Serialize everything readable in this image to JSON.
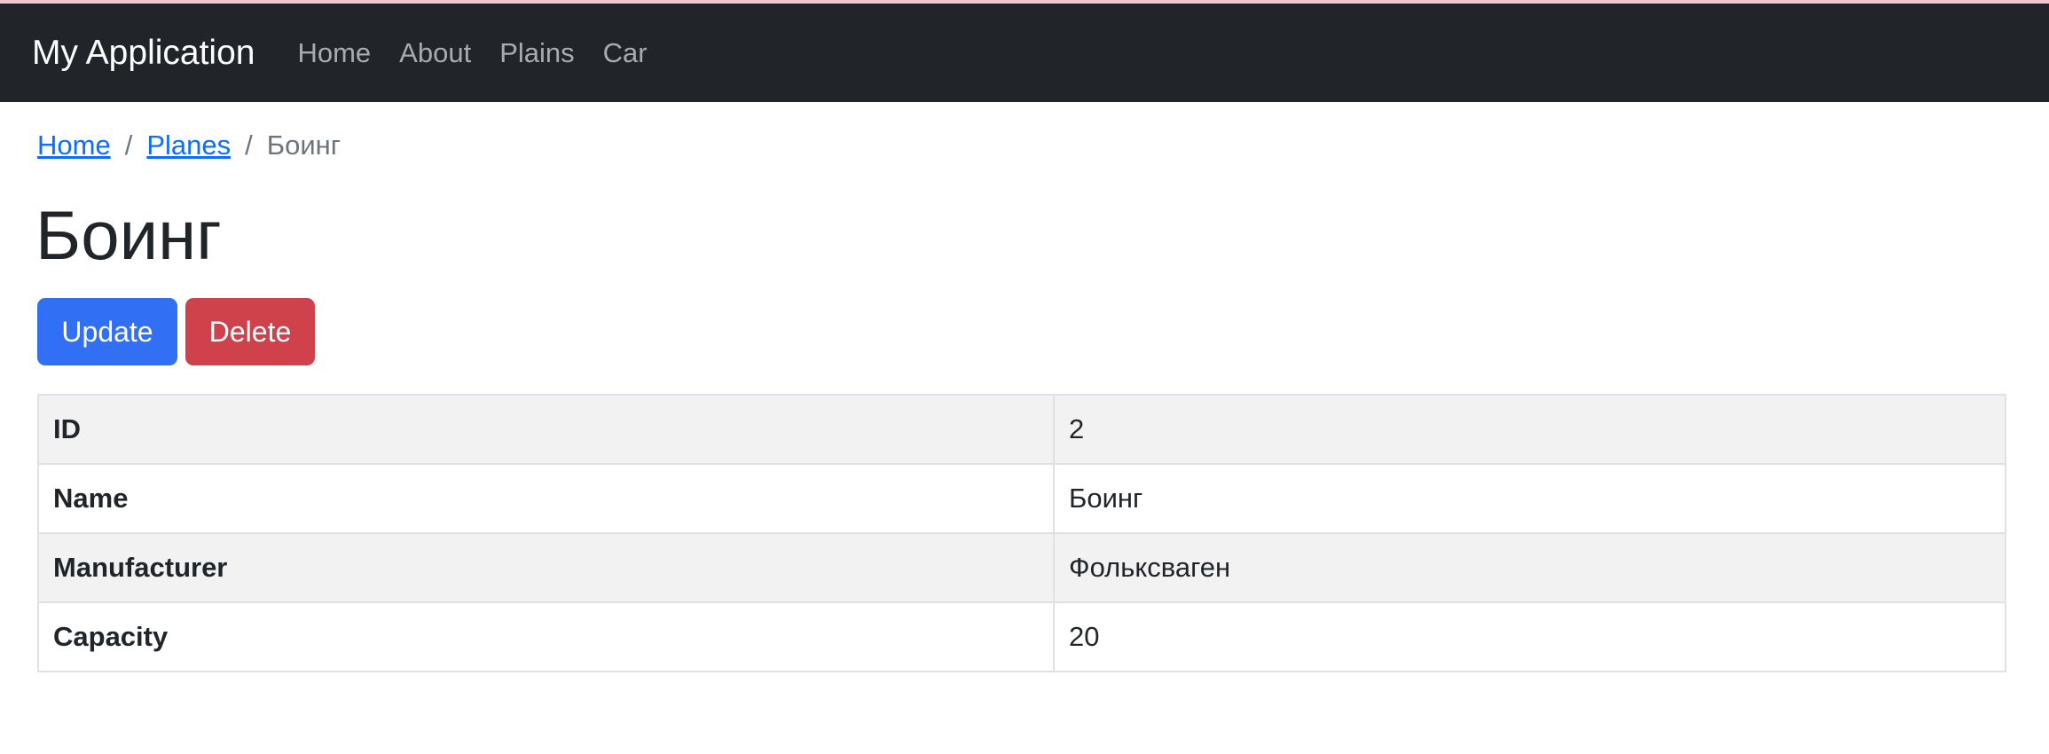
{
  "navbar": {
    "brand": "My Application",
    "links": [
      "Home",
      "About",
      "Plains",
      "Car"
    ]
  },
  "breadcrumb": {
    "items": [
      "Home",
      "Planes"
    ],
    "current": "Боинг",
    "separator": "/"
  },
  "page": {
    "title": "Боинг"
  },
  "actions": {
    "update_label": "Update",
    "delete_label": "Delete"
  },
  "details": [
    {
      "label": "ID",
      "value": "2"
    },
    {
      "label": "Name",
      "value": "Боинг"
    },
    {
      "label": "Manufacturer",
      "value": "Фольксваген"
    },
    {
      "label": "Capacity",
      "value": "20"
    }
  ],
  "colors": {
    "navbar_bg": "#212529",
    "primary": "#3170f4",
    "danger": "#cf424c",
    "link": "#0d6efd"
  }
}
